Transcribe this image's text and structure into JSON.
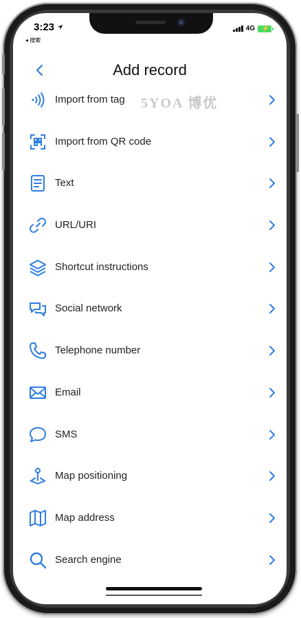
{
  "status_bar": {
    "time": "3:23",
    "back_app": "◂ 搜索",
    "network": "4G"
  },
  "nav": {
    "title": "Add record"
  },
  "watermark": "5YOA 博优",
  "accent_color": "#2f7de1",
  "items": [
    {
      "label": "Import from tag",
      "icon": "nfc-icon"
    },
    {
      "label": "Import from QR code",
      "icon": "qr-scan-icon"
    },
    {
      "label": "Text",
      "icon": "text-document-icon"
    },
    {
      "label": "URL/URI",
      "icon": "link-icon"
    },
    {
      "label": "Shortcut instructions",
      "icon": "layers-icon"
    },
    {
      "label": "Social network",
      "icon": "chat-bubbles-icon"
    },
    {
      "label": "Telephone number",
      "icon": "phone-icon"
    },
    {
      "label": "Email",
      "icon": "envelope-icon"
    },
    {
      "label": "SMS",
      "icon": "message-bubble-icon"
    },
    {
      "label": "Map positioning",
      "icon": "map-pin-icon"
    },
    {
      "label": "Map address",
      "icon": "map-icon"
    },
    {
      "label": "Search engine",
      "icon": "search-icon"
    }
  ]
}
